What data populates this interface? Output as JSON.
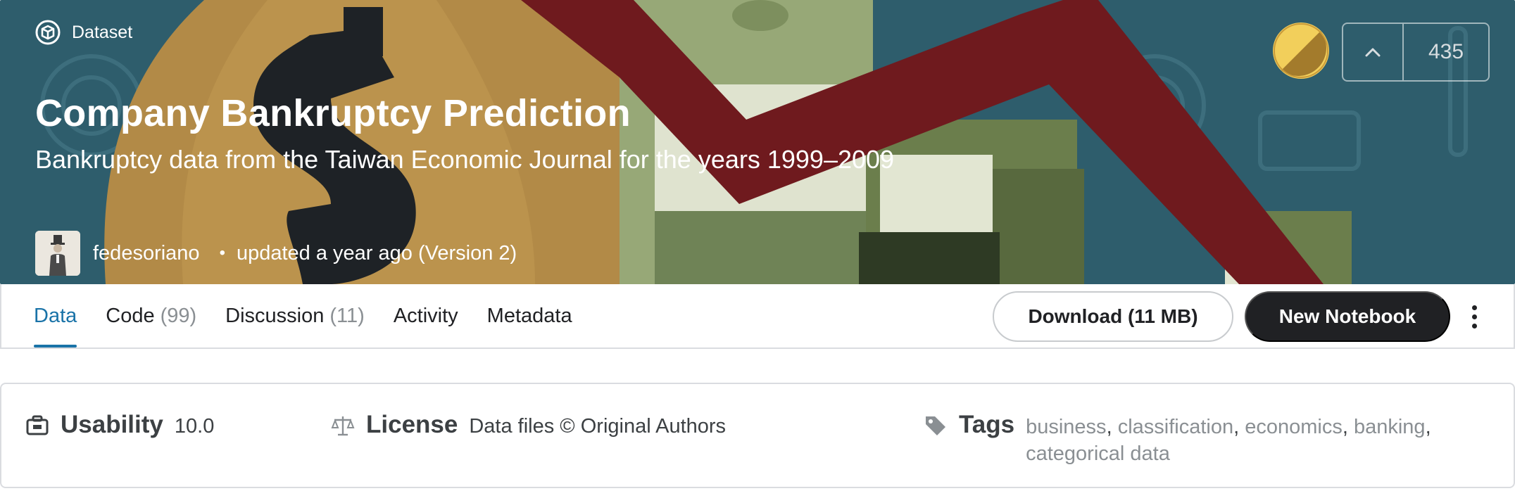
{
  "header": {
    "type_label": "Dataset",
    "title": "Company Bankruptcy Prediction",
    "subtitle": "Bankruptcy data from the Taiwan Economic Journal for the years 1999–2009",
    "author": "fedesoriano",
    "separator": "•",
    "updated": "updated a year ago (Version 2)",
    "upvotes": "435",
    "medal_color": "#f2cf5b"
  },
  "tabs": [
    {
      "label": "Data",
      "count": ""
    },
    {
      "label": "Code",
      "count": "(99)"
    },
    {
      "label": "Discussion",
      "count": "(11)"
    },
    {
      "label": "Activity",
      "count": ""
    },
    {
      "label": "Metadata",
      "count": ""
    }
  ],
  "actions": {
    "download_label": "Download (11 MB)",
    "new_notebook_label": "New Notebook"
  },
  "meta": {
    "usability_label": "Usability",
    "usability_value": "10.0",
    "license_label": "License",
    "license_value": "Data files © Original Authors",
    "tags_label": "Tags",
    "tags": [
      "business",
      "classification",
      "economics",
      "banking",
      "categorical data"
    ]
  },
  "colors": {
    "accent": "#1a73a8",
    "banner_bg": "#2f5e6e",
    "dark_button": "#202124"
  }
}
